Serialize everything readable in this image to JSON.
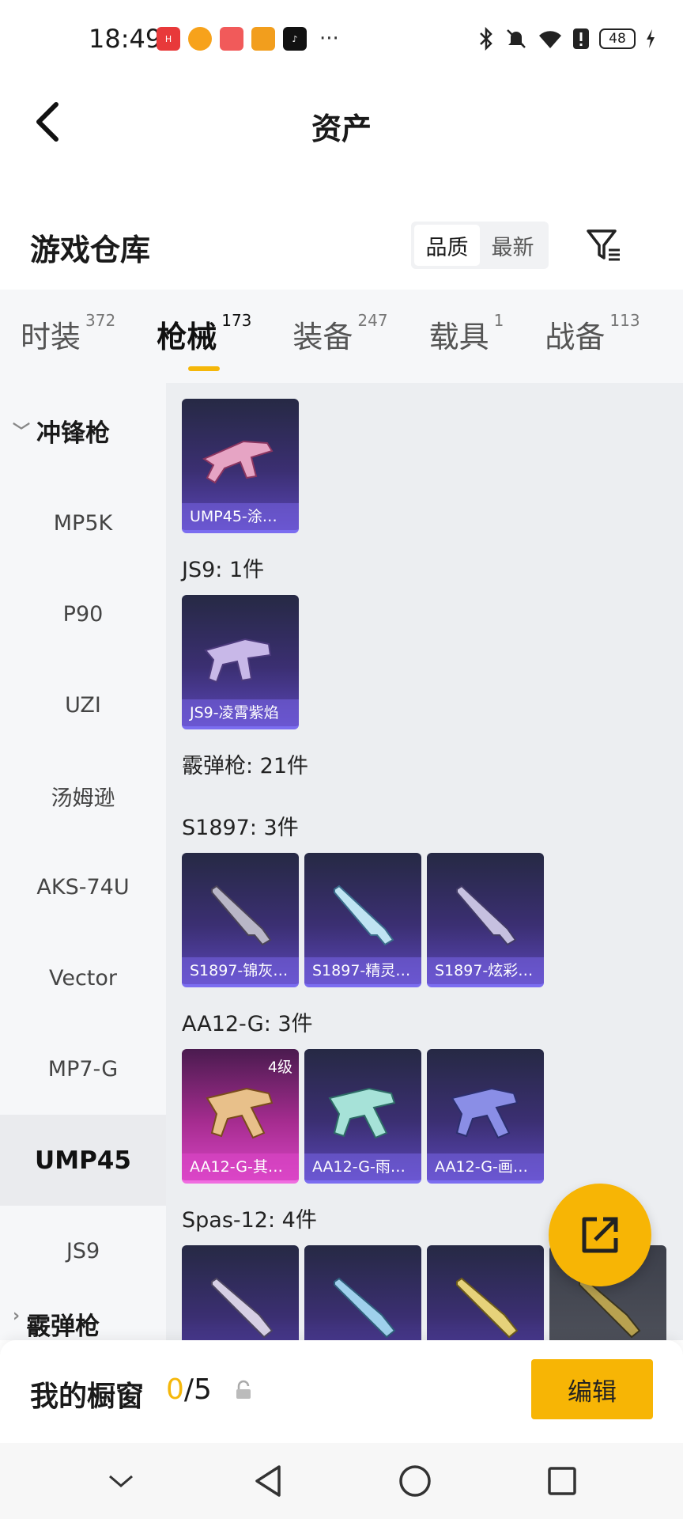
{
  "status_bar": {
    "time": "18:49",
    "battery": "48"
  },
  "header": {
    "title": "资产"
  },
  "warehouse": {
    "title": "游戏仓库",
    "sort_options": [
      "品质",
      "最新"
    ],
    "sort_selected": "品质"
  },
  "tabs": [
    {
      "label": "时装",
      "count": "372",
      "active": false
    },
    {
      "label": "枪械",
      "count": "173",
      "active": true
    },
    {
      "label": "装备",
      "count": "247",
      "active": false
    },
    {
      "label": "载具",
      "count": "1",
      "active": false
    },
    {
      "label": "战备",
      "count": "113",
      "active": false
    }
  ],
  "sidebar": {
    "group": "冲锋枪",
    "items": [
      "MP5K",
      "P90",
      "UZI",
      "汤姆逊",
      "AKS-74U",
      "Vector",
      "MP7-G",
      "UMP45",
      "JS9"
    ],
    "selected": "UMP45",
    "next_group": "霰弹枪"
  },
  "content": {
    "sections": [
      {
        "label": "",
        "cards": [
          {
            "name": "UMP45-涂…"
          }
        ]
      },
      {
        "label": "JS9: 1件",
        "cards": [
          {
            "name": "JS9-凌霄紫焰"
          }
        ]
      },
      {
        "label": "霰弹枪: 21件",
        "cards": []
      },
      {
        "label": "S1897: 3件",
        "cards": [
          {
            "name": "S1897-锦灰…"
          },
          {
            "name": "S1897-精灵…"
          },
          {
            "name": "S1897-炫彩…"
          }
        ]
      },
      {
        "label": "AA12-G: 3件",
        "cards": [
          {
            "name": "AA12-G-其…",
            "tier": "4级"
          },
          {
            "name": "AA12-G-雨…"
          },
          {
            "name": "AA12-G-画…"
          }
        ]
      },
      {
        "label": "Spas-12: 4件",
        "cards": []
      }
    ]
  },
  "showcase": {
    "label": "我的橱窗",
    "current": "0",
    "total": "/5",
    "edit_label": "编辑"
  },
  "colors": {
    "accent": "#f7b505",
    "rare": "#5a46b8",
    "epic": "#d845c4"
  }
}
